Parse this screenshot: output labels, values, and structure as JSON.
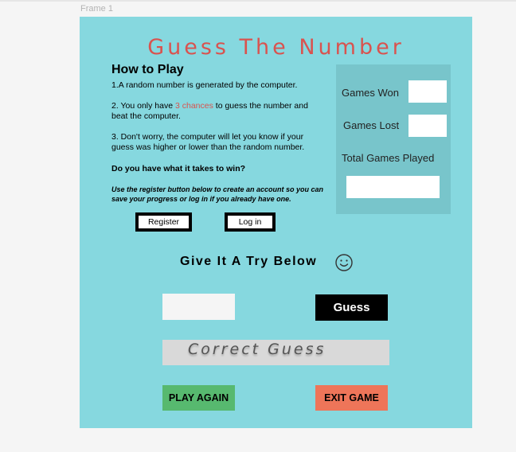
{
  "canvas": {
    "frame_label": "Frame 1"
  },
  "title": "Guess The Number",
  "how_to_play": {
    "heading": "How to Play",
    "rule1": "1.A random number is generated by the computer.",
    "rule2_before": "2. You only have ",
    "rule2_highlight": "3 chances",
    "rule2_after": " to guess the number and beat the computer.",
    "rule3": "3. Don't worry, the computer will let you know if your guess was higher or lower than the random number.",
    "challenge": "Do you have what it takes to win?",
    "register_note": "Use the register button below to create an account so you can save your progress or log in if you already have one."
  },
  "auth": {
    "register_label": "Register",
    "login_label": "Log in"
  },
  "stats": {
    "games_won_label": "Games Won",
    "games_lost_label": "Games Lost",
    "total_label": "Total Games Played"
  },
  "game": {
    "try_heading": "Give It A Try Below",
    "smile_icon": "smiley-face-icon",
    "guess_button": "Guess",
    "result_text": "Correct Guess",
    "play_again": "PLAY AGAIN",
    "exit_game": "EXIT GAME"
  },
  "colors": {
    "frame_bg": "#86d8df",
    "stats_bg": "#78c5cb",
    "title_color": "#d9534f",
    "play_again_bg": "#57b96f",
    "exit_bg": "#ee7559"
  }
}
